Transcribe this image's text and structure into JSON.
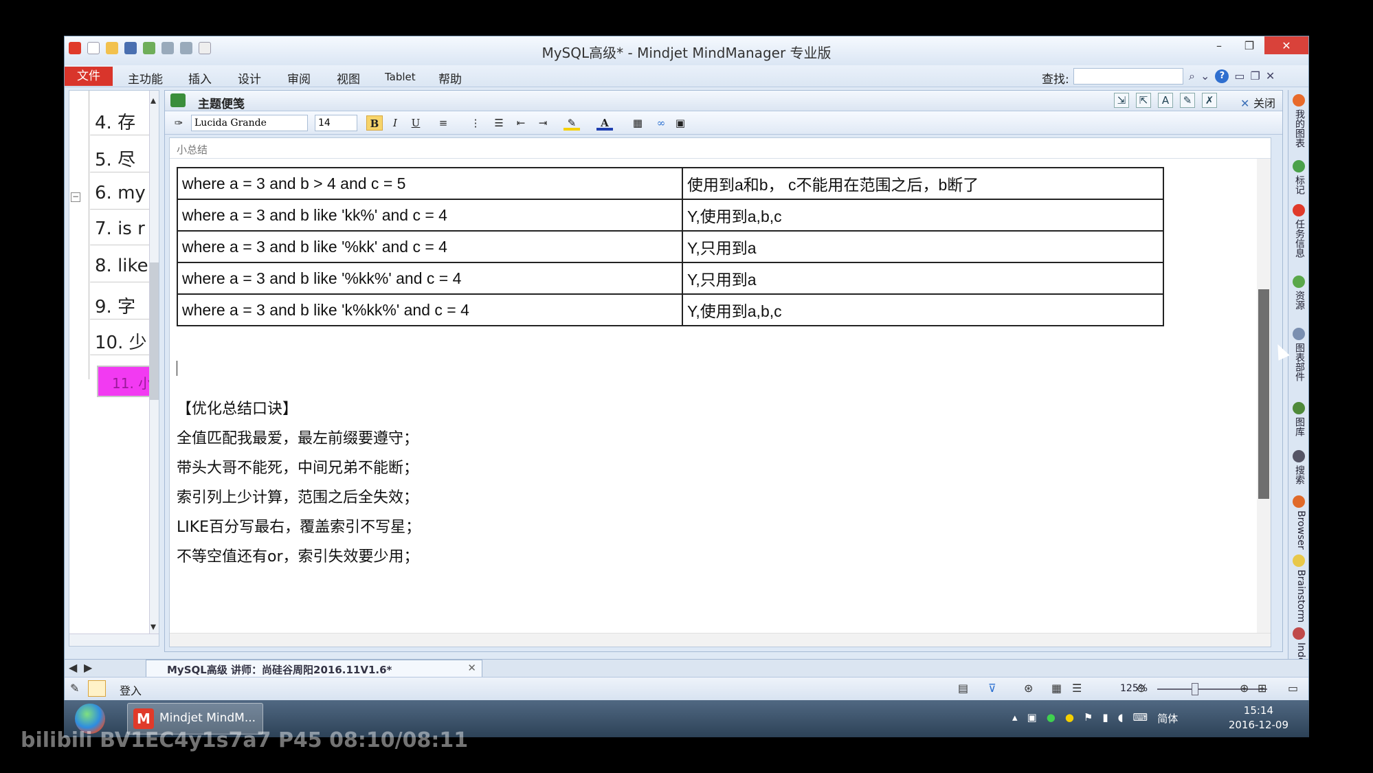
{
  "window": {
    "title": "MySQL高级* - Mindjet MindManager 专业版",
    "min": "–",
    "restore": "❐",
    "close": "✕"
  },
  "menu": {
    "file": "文件",
    "items": [
      "主功能",
      "插入",
      "设计",
      "审阅",
      "视图",
      "Tablet",
      "帮助"
    ],
    "find_label": "查找:",
    "find_value": ""
  },
  "outline": {
    "items": [
      "4. 存",
      "5. 尽",
      "6. my",
      "7. is r",
      "8. like",
      "9. 字",
      "10. 少"
    ],
    "selected": "11. 小"
  },
  "notes": {
    "title": "主题便笺",
    "close": "关闭",
    "font": "Lucida Grande",
    "size": "14",
    "caption": "小总结"
  },
  "table": {
    "rows": [
      [
        "where a = 3 and b > 4 and c = 5",
        "使用到a和b， c不能用在范围之后，b断了"
      ],
      [
        "where a = 3 and b like 'kk%' and c = 4",
        "Y,使用到a,b,c"
      ],
      [
        "where a = 3 and b like '%kk' and c = 4",
        "Y,只用到a"
      ],
      [
        "where a = 3 and b like '%kk%' and c = 4",
        "Y,只用到a"
      ],
      [
        "where a = 3 and b like 'k%kk%' and c = 4",
        "Y,使用到a,b,c"
      ]
    ]
  },
  "mnemonic": {
    "heading": "【优化总结口诀】",
    "lines": [
      "全值匹配我最爱，最左前缀要遵守；",
      "带头大哥不能死，中间兄弟不能断；",
      "索引列上少计算，范围之后全失效；",
      "LIKE百分写最右，覆盖索引不写星；",
      "不等空值还有or，索引失效要少用；"
    ]
  },
  "side_tabs": [
    "我的图表",
    "标记",
    "任务信息",
    "资源",
    "图表部件",
    "图库",
    "搜索",
    "Browser",
    "Brainstorm",
    "Index"
  ],
  "doc_tab": "MySQL高级 讲师：尚硅谷周阳2016.11V1.6*",
  "status": {
    "login": "登入",
    "zoom": "125%",
    "ime": "简体"
  },
  "taskbar": {
    "app": "Mindjet MindM...",
    "time": "15:14",
    "date": "2016-12-09"
  },
  "watermark": "bilibili BV1EC4y1s7a7 P45 08:10/08:11"
}
